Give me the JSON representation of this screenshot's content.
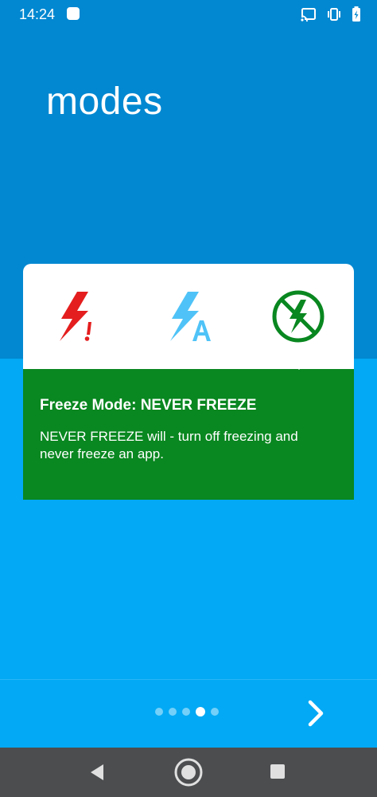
{
  "status_bar": {
    "time": "14:24",
    "icons": [
      "notification-icon",
      "cast-icon",
      "vibrate-icon",
      "battery-icon"
    ]
  },
  "page": {
    "title": "modes"
  },
  "modes": {
    "icons": [
      "aggressive-freeze-icon",
      "auto-freeze-icon",
      "never-freeze-icon"
    ],
    "selected_index": 2,
    "heading": "Freeze Mode: NEVER FREEZE",
    "description": "NEVER FREEZE will - turn off freezing and never freeze an app.",
    "colors": {
      "aggressive": "#e41e1e",
      "auto": "#4fc3f7",
      "never": "#098720"
    }
  },
  "pager": {
    "total": 5,
    "current_index": 3,
    "next_icon": "chevron-right-icon"
  },
  "colors": {
    "header_bg": "#0288d1",
    "body_bg": "#03a9f4",
    "panel_bg": "#098720",
    "nav_bg": "#4b4d4f"
  },
  "nav_bar": {
    "icons": [
      "back-icon",
      "home-icon",
      "recents-icon"
    ]
  }
}
